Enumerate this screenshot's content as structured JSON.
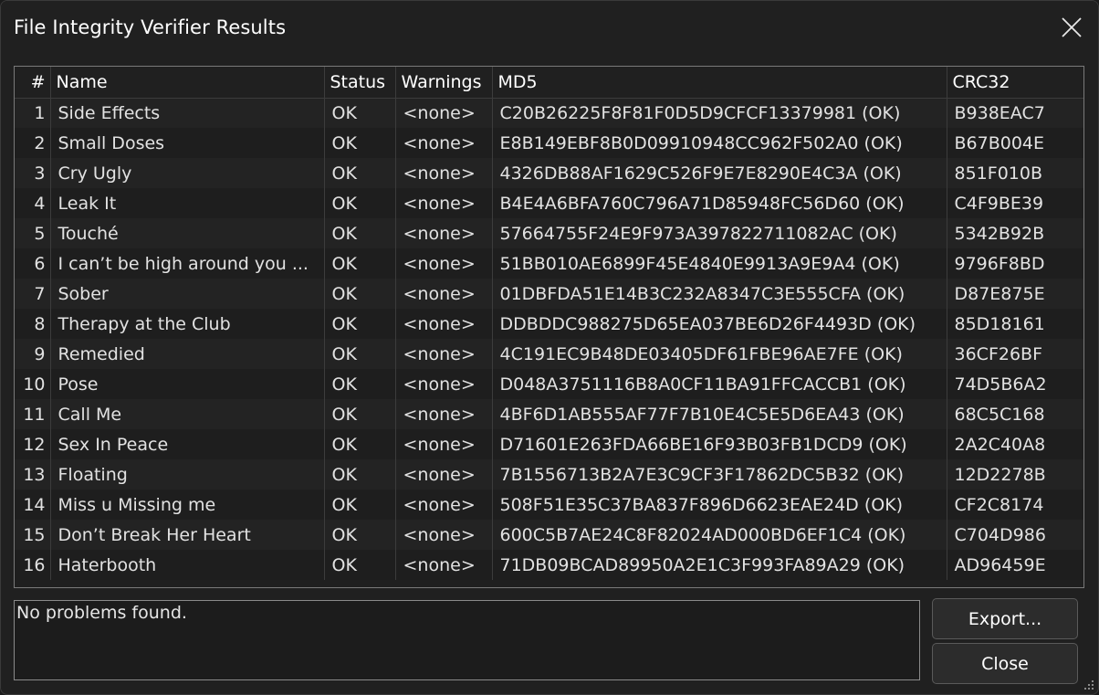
{
  "window": {
    "title": "File Integrity Verifier Results"
  },
  "table": {
    "columns": [
      "#",
      "Name",
      "Status",
      "Warnings",
      "MD5",
      "CRC32"
    ],
    "rows": [
      [
        "1",
        "Side Effects",
        "OK",
        "<none>",
        "C20B26225F8F81F0D5D9CFCF13379981 (OK)",
        "B938EAC7"
      ],
      [
        "2",
        "Small Doses",
        "OK",
        "<none>",
        "E8B149EBF8B0D09910948CC962F502A0 (OK)",
        "B67B004E"
      ],
      [
        "3",
        "Cry Ugly",
        "OK",
        "<none>",
        "4326DB88AF1629C526F9E7E8290E4C3A (OK)",
        "851F010B"
      ],
      [
        "4",
        "Leak It",
        "OK",
        "<none>",
        "B4E4A6BFA760C796A71D85948FC56D60 (OK)",
        "C4F9BE39"
      ],
      [
        "5",
        "Touché",
        "OK",
        "<none>",
        "57664755F24E9F973A397822711082AC (OK)",
        "5342B92B"
      ],
      [
        "6",
        "I can’t be high around you ...",
        "OK",
        "<none>",
        "51BB010AE6899F45E4840E9913A9E9A4 (OK)",
        "9796F8BD"
      ],
      [
        "7",
        "Sober",
        "OK",
        "<none>",
        "01DBFDA51E14B3C232A8347C3E555CFA (OK)",
        "D87E875E"
      ],
      [
        "8",
        "Therapy at the Club",
        "OK",
        "<none>",
        "DDBDDC988275D65EA037BE6D26F4493D (OK)",
        "85D18161"
      ],
      [
        "9",
        "Remedied",
        "OK",
        "<none>",
        "4C191EC9B48DE03405DF61FBE96AE7FE (OK)",
        "36CF26BF"
      ],
      [
        "10",
        "Pose",
        "OK",
        "<none>",
        "D048A3751116B8A0CF11BA91FFCACCB1 (OK)",
        "74D5B6A2"
      ],
      [
        "11",
        "Call Me",
        "OK",
        "<none>",
        "4BF6D1AB555AF77F7B10E4C5E5D6EA43 (OK)",
        "68C5C168"
      ],
      [
        "12",
        "Sex In Peace",
        "OK",
        "<none>",
        "D71601E263FDA66BE16F93B03FB1DCD9 (OK)",
        "2A2C40A8"
      ],
      [
        "13",
        "Floating",
        "OK",
        "<none>",
        "7B1556713B2A7E3C9CF3F17862DC5B32 (OK)",
        "12D2278B"
      ],
      [
        "14",
        "Miss u Missing me",
        "OK",
        "<none>",
        "508F51E35C37BA837F896D6623EAE24D (OK)",
        "CF2C8174"
      ],
      [
        "15",
        "Don’t Break Her Heart",
        "OK",
        "<none>",
        "600C5B7AE24C8F82024AD000BD6EF1C4 (OK)",
        "C704D986"
      ],
      [
        "16",
        "Haterbooth",
        "OK",
        "<none>",
        "71DB09BCAD89950A2E1C3F993FA89A29 (OK)",
        "AD96459E"
      ]
    ]
  },
  "message": "No problems found.",
  "buttons": {
    "export_label": "Export...",
    "close_label": "Close"
  },
  "icons": {
    "close": "close-icon",
    "resize": "resize-grip-icon"
  },
  "colors": {
    "background": "#202020",
    "text": "#e6e6e6",
    "border": "#7a7a7a"
  }
}
